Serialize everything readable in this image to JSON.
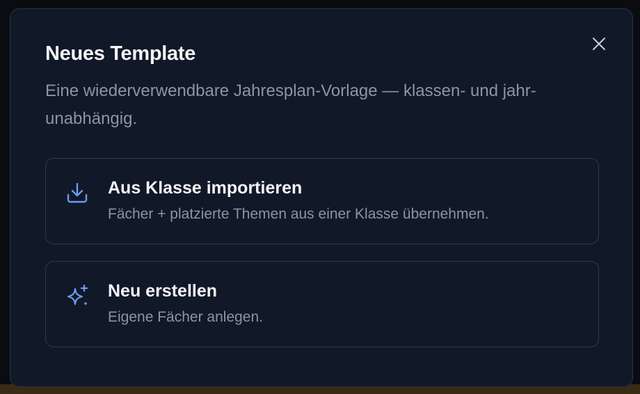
{
  "dialog": {
    "title": "Neues Template",
    "subtitle": "Eine wiederverwendbare Jahresplan-Vorlage — klassen- und jahr-unabhängig.",
    "close_icon": "close-icon",
    "options": [
      {
        "icon": "download-icon",
        "title": "Aus Klasse importieren",
        "description": "Fächer + platzierte Themen aus einer Klasse übernehmen."
      },
      {
        "icon": "sparkles-icon",
        "title": "Neu erstellen",
        "description": "Eigene Fächer anlegen."
      }
    ]
  },
  "colors": {
    "accent_icon": "#6b9cf0",
    "background": "#111827",
    "border": "#2f3a4c",
    "text_primary": "#f3f4f6",
    "text_secondary": "#8b95a7"
  }
}
